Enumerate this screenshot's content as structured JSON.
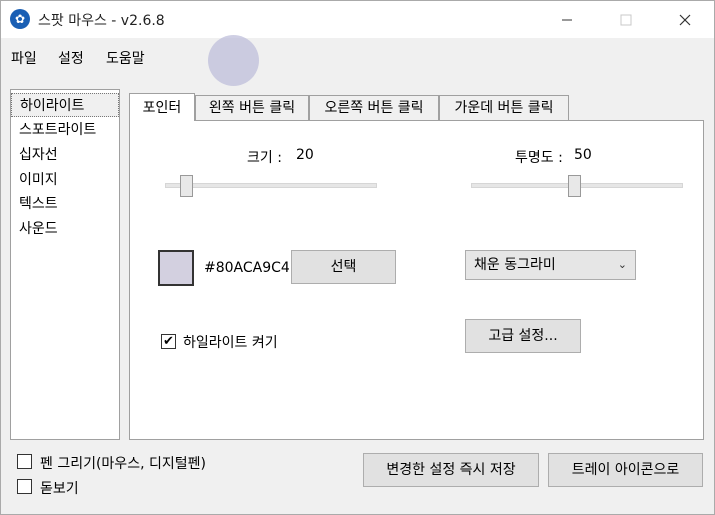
{
  "window": {
    "title": "스팟 마우스 - v2.6.8",
    "icon": "app-logo-icon"
  },
  "menu": [
    "파일",
    "설정",
    "도움말"
  ],
  "sidebar": {
    "items": [
      {
        "label": "하이라이트",
        "selected": true
      },
      {
        "label": "스포트라이트"
      },
      {
        "label": "십자선"
      },
      {
        "label": "이미지"
      },
      {
        "label": "텍스트"
      },
      {
        "label": "사운드"
      }
    ]
  },
  "tabs": [
    {
      "label": "포인터",
      "active": true
    },
    {
      "label": "왼쪽 버튼 클릭"
    },
    {
      "label": "오른쪽 버튼 클릭"
    },
    {
      "label": "가운데 버튼 클릭"
    }
  ],
  "pointer": {
    "size_label": "크기 :",
    "size_value": "20",
    "size_fraction": 0.05,
    "opacity_label": "투명도 :",
    "opacity_value": "50",
    "opacity_fraction": 0.5,
    "color_hex": "#80ACA9C4",
    "swatch_color": "#d3d0e0",
    "select_button": "선택",
    "shape_value": "채운 동그라미",
    "highlight_label": "하일라이트 켜기",
    "highlight_checked": true,
    "advanced_button": "고급 설정..."
  },
  "footer": {
    "pen_label": "펜 그리기(마우스, 디지털펜)",
    "pen_checked": false,
    "magnifier_label": "돋보기",
    "magnifier_checked": false,
    "save_button": "변경한 설정 즉시 저장",
    "tray_button": "트레이 아이콘으로"
  }
}
